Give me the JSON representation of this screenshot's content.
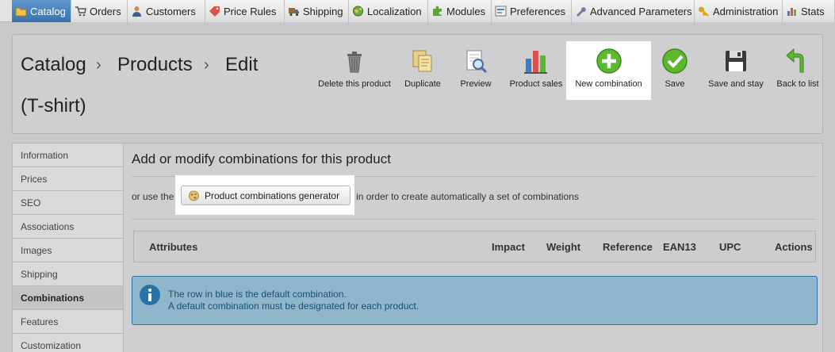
{
  "nav": {
    "tabs": [
      {
        "label": "Catalog",
        "icon": "folder-icon",
        "active": true
      },
      {
        "label": "Orders",
        "icon": "cart-icon"
      },
      {
        "label": "Customers",
        "icon": "user-icon"
      },
      {
        "label": "Price Rules",
        "icon": "price-tag-icon"
      },
      {
        "label": "Shipping",
        "icon": "truck-icon"
      },
      {
        "label": "Localization",
        "icon": "globe-icon"
      },
      {
        "label": "Modules",
        "icon": "puzzle-icon"
      },
      {
        "label": "Preferences",
        "icon": "preferences-icon"
      },
      {
        "label": "Advanced Parameters",
        "icon": "wrench-icon"
      },
      {
        "label": "Administration",
        "icon": "key-icon"
      },
      {
        "label": "Stats",
        "icon": "bar-chart-icon"
      }
    ]
  },
  "header": {
    "breadcrumb": [
      "Catalog",
      "Products",
      "Edit"
    ],
    "separator": "›",
    "subtitle": "(T-shirt)",
    "toolbar": [
      {
        "label": "Delete this product",
        "icon": "trash-icon"
      },
      {
        "label": "Duplicate",
        "icon": "duplicate-icon"
      },
      {
        "label": "Preview",
        "icon": "preview-icon"
      },
      {
        "label": "Product sales",
        "icon": "sales-chart-icon"
      },
      {
        "label": "New combination",
        "icon": "plus-icon",
        "highlighted": true
      },
      {
        "label": "Save",
        "icon": "checkmark-icon"
      },
      {
        "label": "Save and stay",
        "icon": "floppy-icon"
      },
      {
        "label": "Back to list",
        "icon": "back-arrow-icon"
      }
    ]
  },
  "sidebar": {
    "items": [
      {
        "label": "Information"
      },
      {
        "label": "Prices"
      },
      {
        "label": "SEO"
      },
      {
        "label": "Associations"
      },
      {
        "label": "Images"
      },
      {
        "label": "Shipping"
      },
      {
        "label": "Combinations",
        "active": true
      },
      {
        "label": "Features"
      },
      {
        "label": "Customization"
      }
    ]
  },
  "main": {
    "title": "Add or modify combinations for this product",
    "generator": {
      "prefix": "or use the",
      "button_label": "Product combinations generator",
      "suffix": "in order to create automatically a set of combinations"
    },
    "table": {
      "columns": [
        "Attributes",
        "Impact",
        "Weight",
        "Reference",
        "EAN13",
        "UPC",
        "Actions"
      ]
    },
    "info": {
      "line1": "The row in blue is the default combination.",
      "line2": "A default combination must be designated for each product."
    }
  },
  "colors": {
    "active_tab": "#4a84bf",
    "alert_bg": "#8fb6c9",
    "alert_border": "#2a73a8",
    "plus_green": "#5cb82e"
  }
}
